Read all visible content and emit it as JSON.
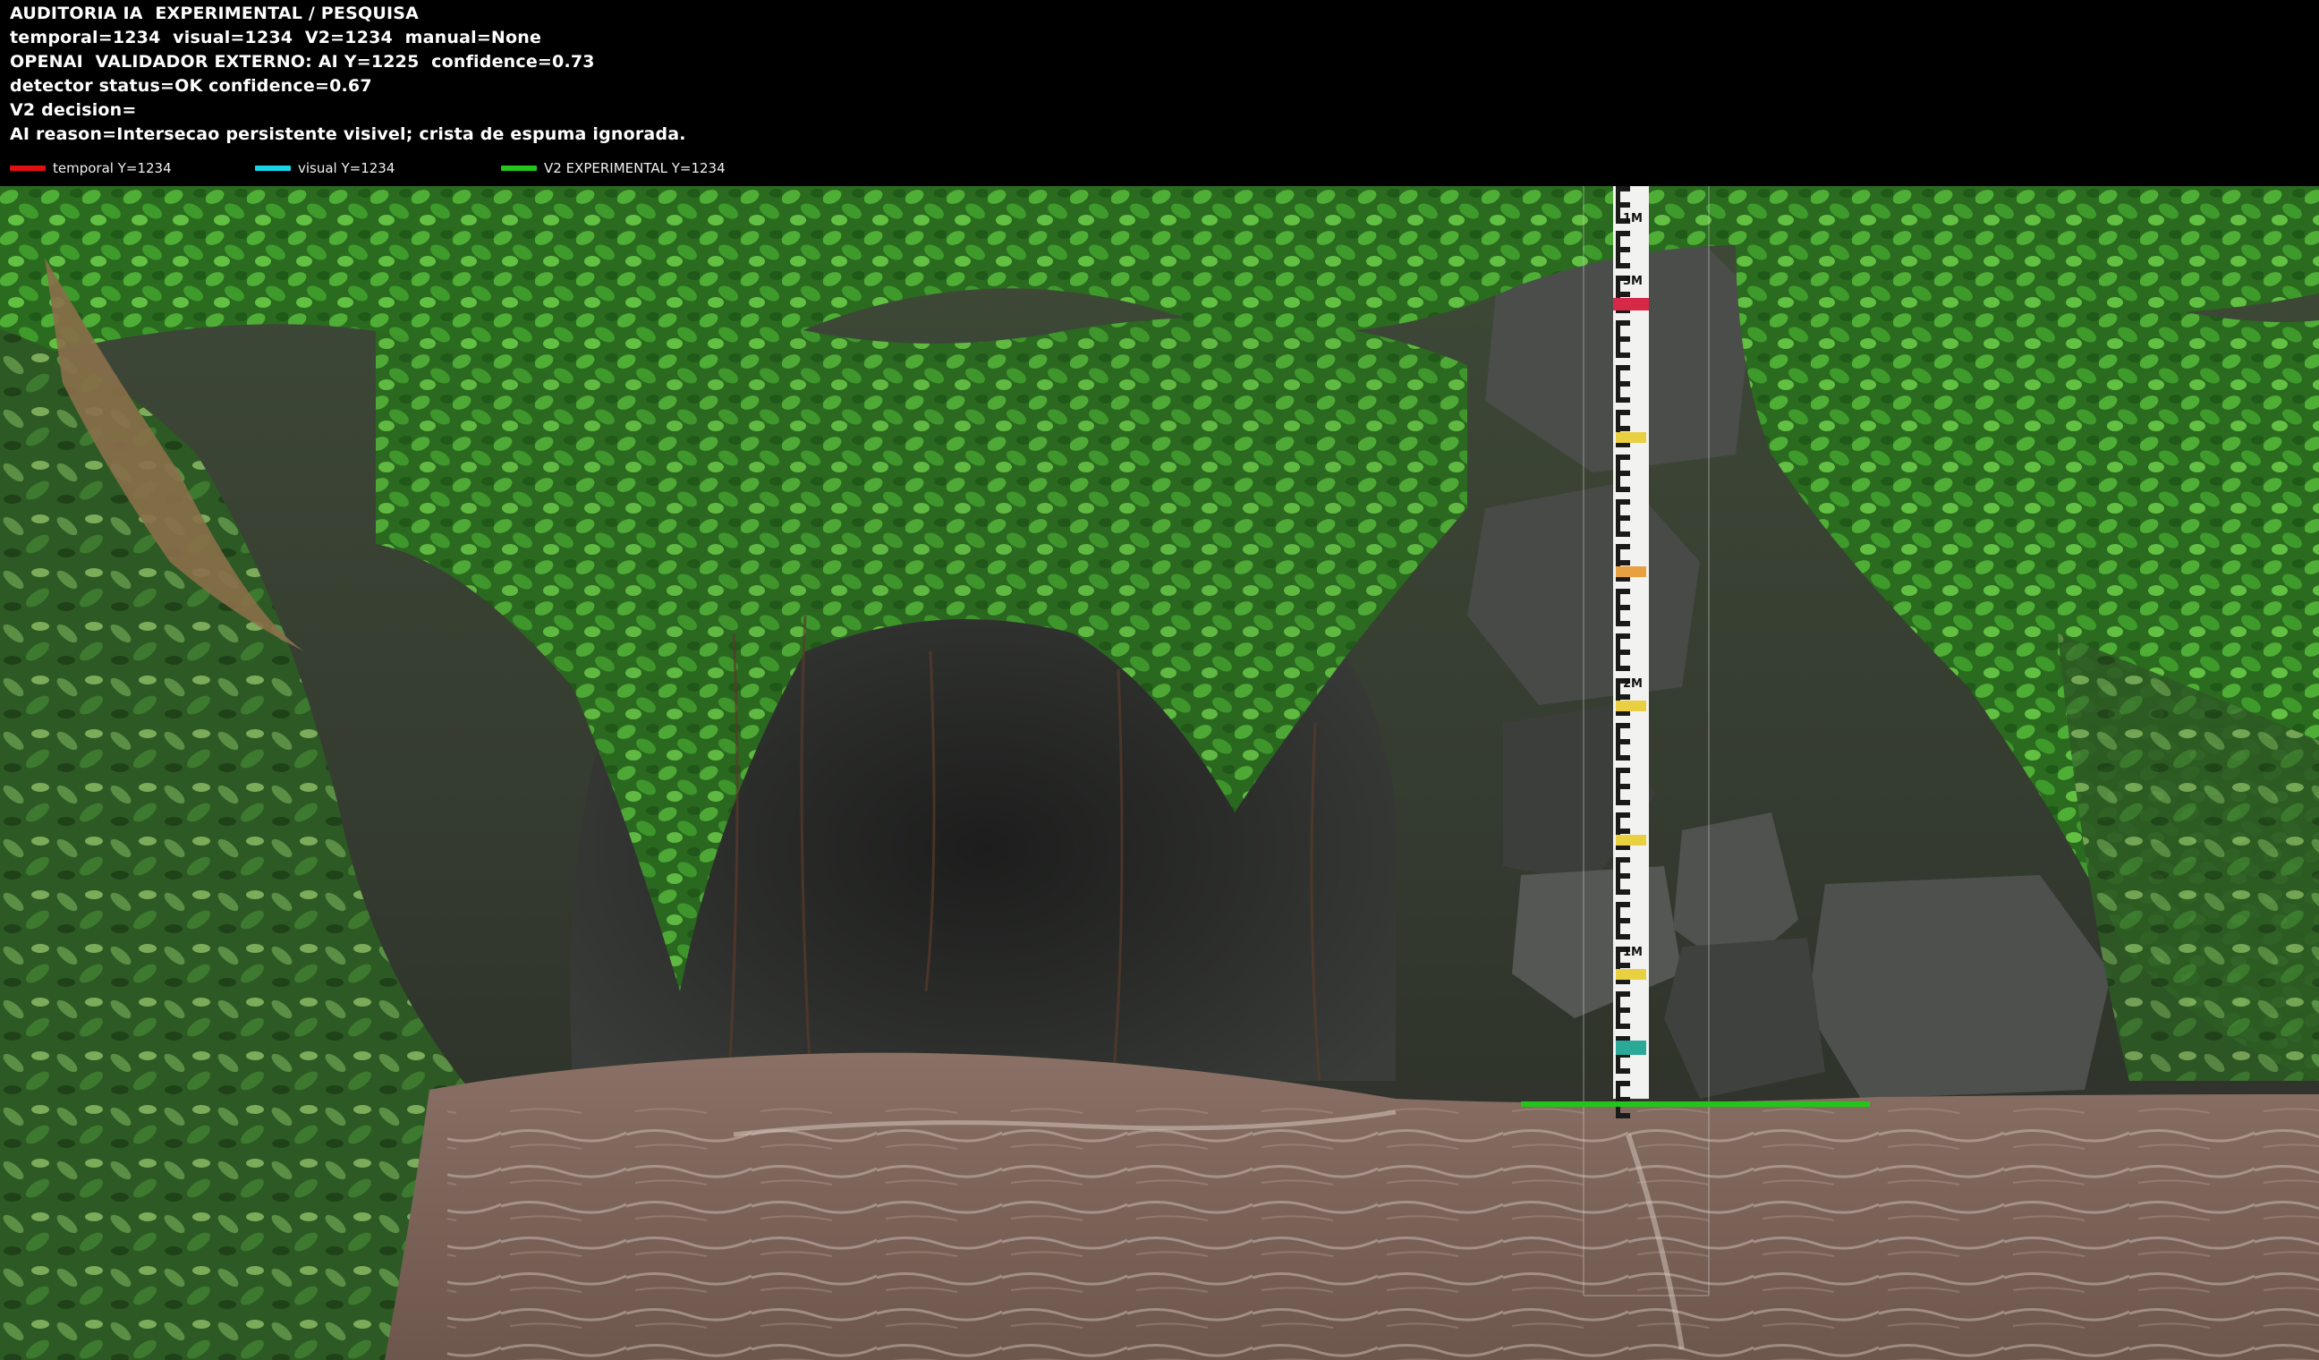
{
  "hud": {
    "title": "AUDITORIA IA  EXPERIMENTAL / PESQUISA",
    "line_estimates": "temporal=1234  visual=1234  V2=1234  manual=None",
    "line_openai": "OPENAI  VALIDADOR EXTERNO: AI Y=1225  confidence=0.73",
    "line_detector": "detector status=OK confidence=0.67",
    "line_decision": "V2 decision=",
    "line_reason": "AI reason=Intersecao persistente visivel; crista de espuma ignorada."
  },
  "legend": {
    "temporal": {
      "label": "temporal Y=1234",
      "color": "#e01010"
    },
    "visual": {
      "label": "visual Y=1234",
      "color": "#19d4e8"
    },
    "v2": {
      "label": "V2 EXPERIMENTAL Y=1234",
      "color": "#22c51a"
    }
  },
  "gauge": {
    "marks": [
      "1M",
      "3M",
      "2M",
      "1M"
    ]
  },
  "scene_colors": {
    "water": "#7d645a",
    "rock": "#3a3a3a",
    "foliage": "#2f7a22",
    "waterline": "#22c51a"
  }
}
